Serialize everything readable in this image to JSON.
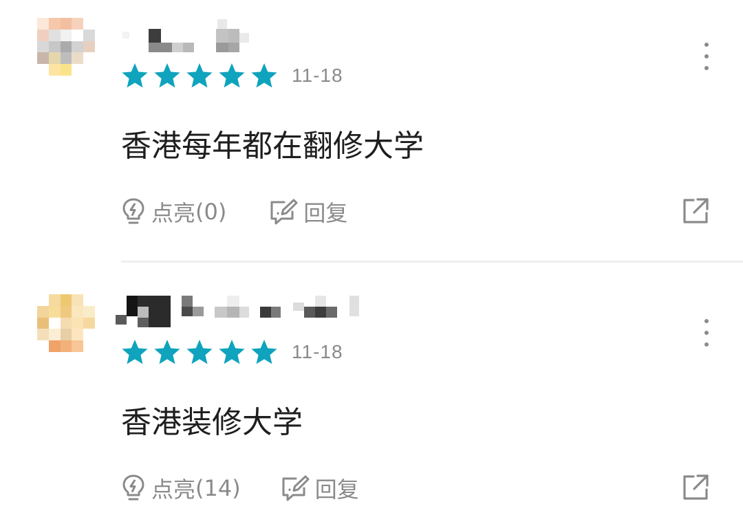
{
  "comments": [
    {
      "username": "",
      "rating": 5,
      "date": "11-18",
      "content": "香港每年都在翻修大学",
      "like_label": "点亮",
      "like_count": "(0)",
      "reply_label": "回复"
    },
    {
      "username": "",
      "rating": 5,
      "date": "11-18",
      "content": "香港装修大学",
      "like_label": "点亮",
      "like_count": "(14)",
      "reply_label": "回复"
    }
  ],
  "colors": {
    "star": "#0fa3bd",
    "muted": "#8a8a8a",
    "text": "#1e1e1e",
    "divider": "#eeeeee"
  },
  "icons": [
    "avatar",
    "star-icon",
    "more-vertical-icon",
    "lightbulb-icon",
    "edit-reply-icon",
    "share-external-icon"
  ]
}
